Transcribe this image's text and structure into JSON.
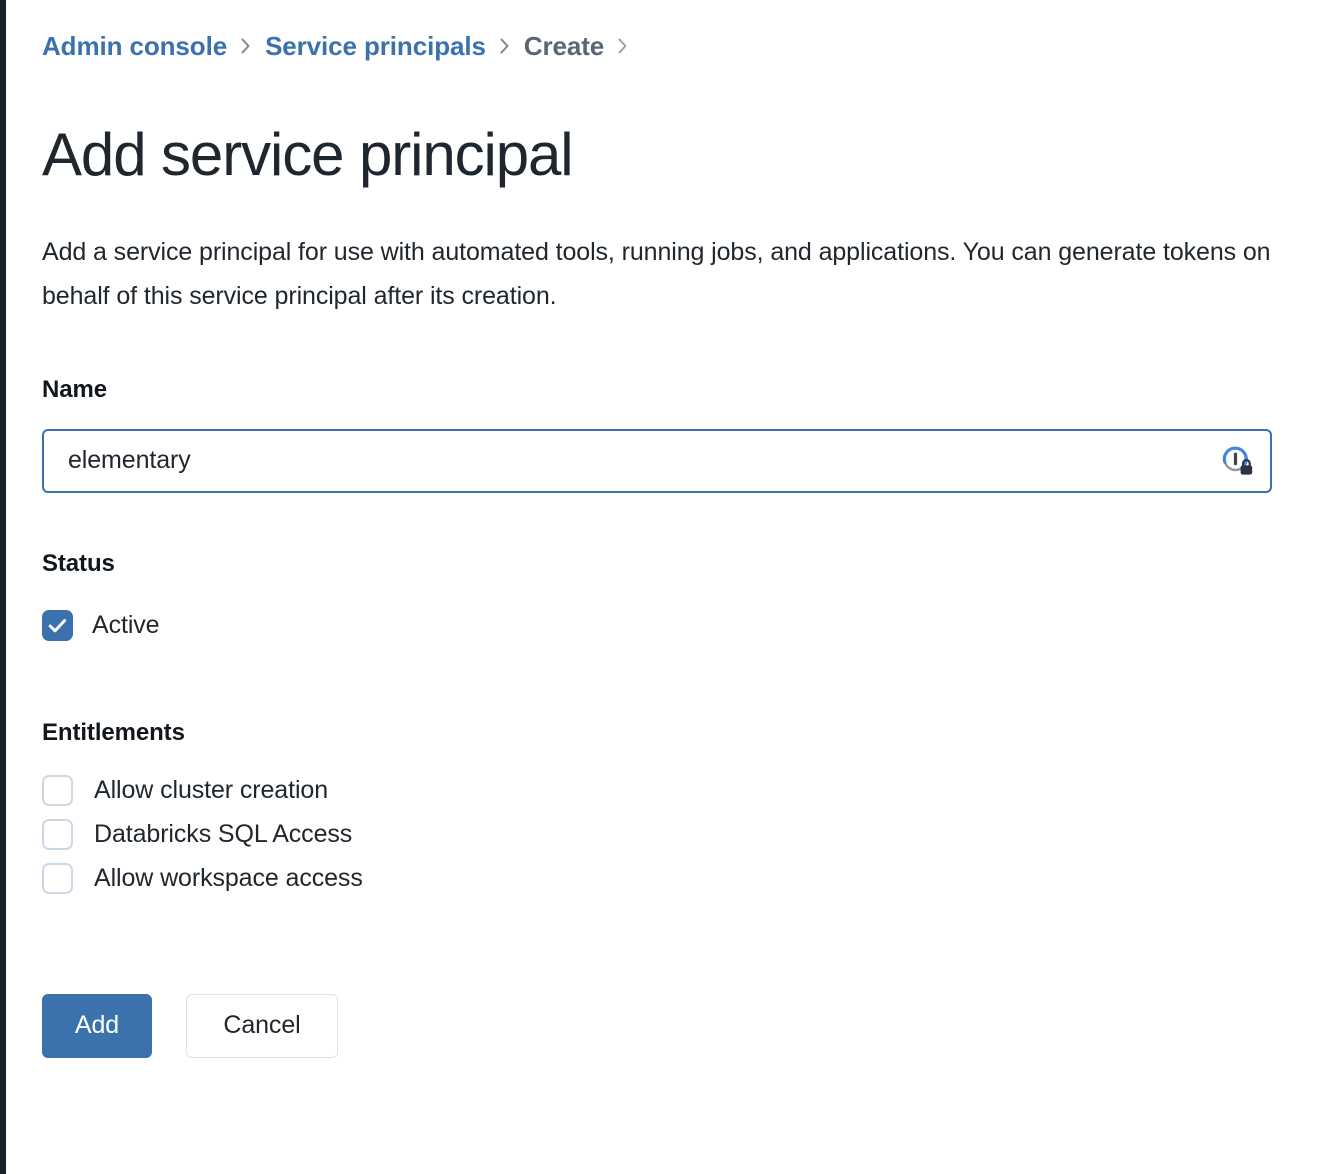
{
  "breadcrumb": {
    "items": [
      {
        "label": "Admin console",
        "type": "link"
      },
      {
        "label": "Service principals",
        "type": "link"
      },
      {
        "label": "Create",
        "type": "current"
      }
    ],
    "separator": "›",
    "link_color": "#3b72ad",
    "current_color": "#5b6574"
  },
  "page": {
    "title": "Add service principal",
    "description": "Add a service principal for use with automated tools, running jobs, and applications. You can generate tokens on behalf of this service principal after its creation."
  },
  "form": {
    "name": {
      "label": "Name",
      "value": "elementary",
      "placeholder": "",
      "focused": true,
      "icon": "password-manager-lock-icon"
    },
    "status": {
      "label": "Status",
      "option": {
        "label": "Active",
        "checked": true
      }
    },
    "entitlements": {
      "label": "Entitlements",
      "options": [
        {
          "label": "Allow cluster creation",
          "checked": false
        },
        {
          "label": "Databricks SQL Access",
          "checked": false
        },
        {
          "label": "Allow workspace access",
          "checked": false
        }
      ]
    }
  },
  "actions": {
    "submit_label": "Add",
    "cancel_label": "Cancel"
  },
  "theme": {
    "accent": "#3b72ad",
    "text": "#1f262d",
    "muted": "#5b6574",
    "checkbox_border": "#ccd8e4",
    "secondary_border": "#dbe3ec",
    "rail": "#1b2227"
  }
}
